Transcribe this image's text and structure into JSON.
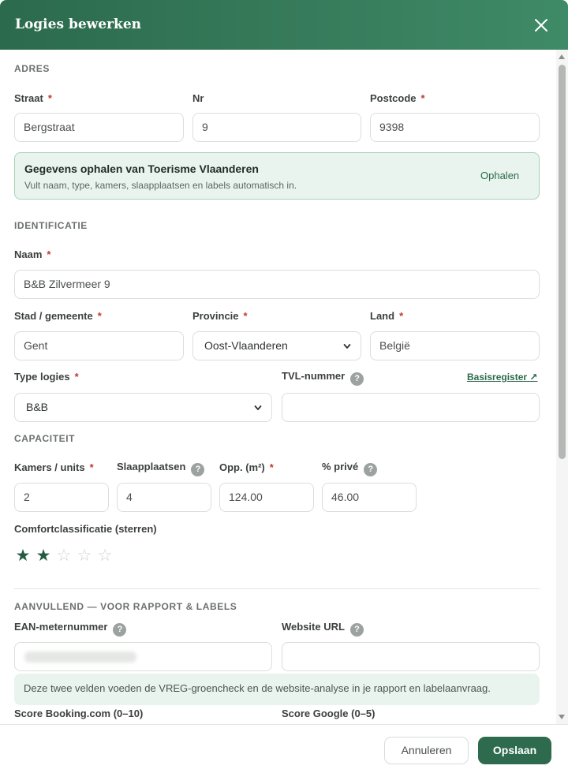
{
  "modal": {
    "title": "Logies bewerken"
  },
  "adres": {
    "section_title": "ADRES",
    "straat": {
      "label": "Straat",
      "value": "Bergstraat"
    },
    "nr": {
      "label": "Nr",
      "value": "9"
    },
    "postcode": {
      "label": "Postcode",
      "value": "9398"
    }
  },
  "callout": {
    "title": "Gegevens ophalen van Toerisme Vlaanderen",
    "desc": "Vult naam, type, kamers, slaapplaatsen en labels automatisch in.",
    "button": "Ophalen"
  },
  "identificatie": {
    "section_title": "IDENTIFICATIE",
    "naam": {
      "label": "Naam",
      "value": "B&B Zilvermeer 9"
    },
    "stad": {
      "label": "Stad / gemeente",
      "value": "Gent"
    },
    "provincie": {
      "label": "Provincie",
      "value": "Oost-Vlaanderen"
    },
    "land": {
      "label": "Land",
      "value": "België"
    },
    "type": {
      "label": "Type logies",
      "value": "B&B"
    },
    "tvl": {
      "label": "TVL-nummer",
      "value": "",
      "link": "Basisregister ↗"
    }
  },
  "capaciteit": {
    "section_title": "CAPACITEIT",
    "kamers": {
      "label": "Kamers / units",
      "value": "2"
    },
    "slaapplaatsen": {
      "label": "Slaapplaatsen",
      "value": "4"
    },
    "opp": {
      "label": "Opp. (m²)",
      "value": "124.00"
    },
    "prive": {
      "label": "% privé",
      "value": "46.00"
    },
    "comfort": {
      "label": "Comfortclassificatie (sterren)",
      "rating": 2,
      "max": 5
    }
  },
  "aanvullend": {
    "section_title": "AANVULLEND — VOOR RAPPORT & LABELS",
    "ean": {
      "label": "EAN-meternummer"
    },
    "website": {
      "label": "Website URL",
      "value": ""
    },
    "note": "Deze twee velden voeden de VREG-groencheck en de website-analyse in je rapport en labelaanvraag.",
    "booking": {
      "label": "Score Booking.com (0–10)"
    },
    "google": {
      "label": "Score Google (0–5)"
    }
  },
  "footer": {
    "cancel": "Annuleren",
    "save": "Opslaan"
  },
  "common": {
    "required": "*",
    "help": "?",
    "star_on": "★",
    "star_off": "☆"
  },
  "colors": {
    "brand": "#2e6b4e",
    "accent_bg": "#eaf4ee",
    "required": "#c0392b"
  }
}
